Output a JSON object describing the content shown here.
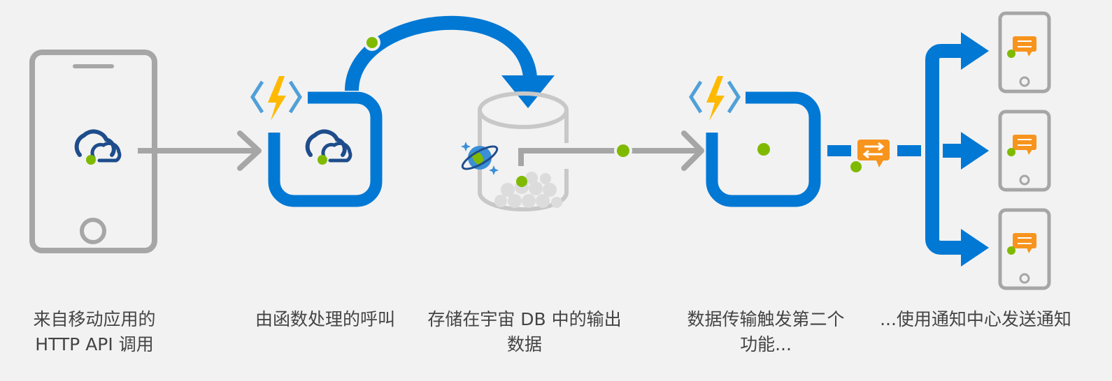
{
  "colors": {
    "background": "#f2f2f2",
    "azure_blue": "#0078d4",
    "gray": "#a6a6a6",
    "dot_green": "#7fba00",
    "cloud_navy": "#1e4d8c",
    "bolt_yellow": "#ffb900",
    "bracket_blue": "#50a0d8",
    "notify_orange": "#f7941d",
    "caption_text": "#444444"
  },
  "icons": [
    "phone-icon",
    "cloud-api-icon",
    "azure-function-icon",
    "cosmos-db-icon",
    "database-cylinder-icon",
    "notification-hub-icon"
  ],
  "captions": {
    "step1": {
      "line1": "来自移动应用的",
      "line2": "HTTP API 调用"
    },
    "step2": {
      "line1": "由函数处理的呼叫"
    },
    "step3": {
      "line1": "存储在宇宙 DB 中的输出",
      "line2": "数据"
    },
    "step4": {
      "line1": "数据传输触发第二个",
      "line2": "功能..."
    },
    "step5": {
      "line1": "...使用通知中心发送通知"
    }
  }
}
